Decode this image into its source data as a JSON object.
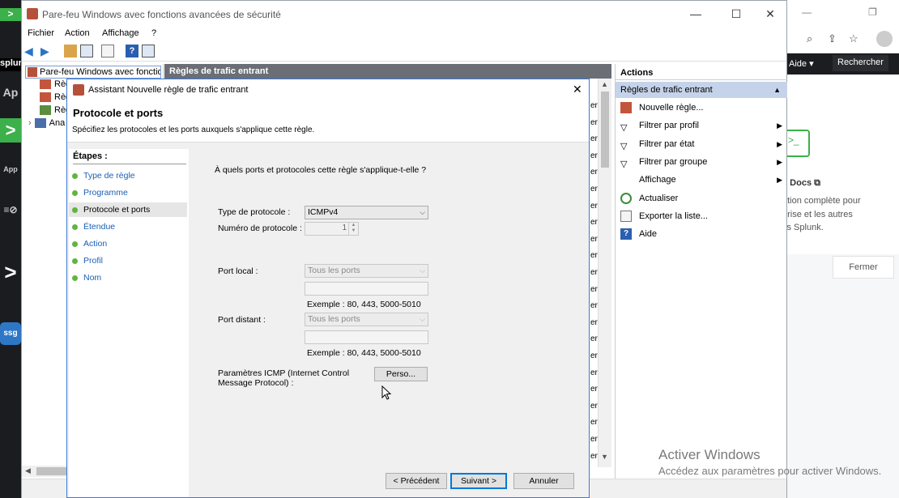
{
  "background": {
    "right_top_labels": [
      "Aide ▾",
      "Rechercher"
    ],
    "card_title": "k Docs",
    "card_lines": [
      "ation complète pour",
      "prise et les autres",
      "its Splunk."
    ],
    "close_button": "Fermer",
    "left_tiles": [
      ">",
      "Ap",
      ">",
      "App",
      "≡⊘",
      ">",
      "ssg"
    ],
    "brand": "splun"
  },
  "mmc": {
    "title": "Pare-feu Windows avec fonctions avancées de sécurité",
    "menu": [
      "Fichier",
      "Action",
      "Affichage",
      "?"
    ],
    "tree": {
      "root": "Pare-feu Windows avec fonctio",
      "nodes": [
        "Règ",
        "Règ",
        "Règ",
        "Ana"
      ]
    },
    "center_header": "Règles de trafic entrant",
    "list_marker": "er",
    "actions": {
      "header": "Actions",
      "section": "Règles de trafic entrant",
      "items": [
        {
          "label": "Nouvelle règle...",
          "icon": "new-rule-icon",
          "submenu": false
        },
        {
          "label": "Filtrer par profil",
          "icon": "filter-icon",
          "submenu": true
        },
        {
          "label": "Filtrer par état",
          "icon": "filter-icon",
          "submenu": true
        },
        {
          "label": "Filtrer par groupe",
          "icon": "filter-icon",
          "submenu": true
        },
        {
          "label": "Affichage",
          "icon": "none",
          "submenu": true
        },
        {
          "label": "Actualiser",
          "icon": "refresh-icon",
          "submenu": false
        },
        {
          "label": "Exporter la liste...",
          "icon": "export-icon",
          "submenu": false
        },
        {
          "label": "Aide",
          "icon": "help-icon",
          "submenu": false
        }
      ]
    }
  },
  "wizard": {
    "title": "Assistant Nouvelle règle de trafic entrant",
    "heading": "Protocole et ports",
    "description": "Spécifiez les protocoles et les ports auxquels s'applique cette règle.",
    "steps_title": "Étapes :",
    "steps": [
      "Type de règle",
      "Programme",
      "Protocole et ports",
      "Étendue",
      "Action",
      "Profil",
      "Nom"
    ],
    "current_step": "Protocole et ports",
    "question": "À quels ports et protocoles cette règle s'applique-t-elle ?",
    "protocol_type_label": "Type de protocole :",
    "protocol_type_value": "ICMPv4",
    "protocol_number_label": "Numéro de protocole :",
    "protocol_number_value": "1",
    "local_port_label": "Port local :",
    "local_port_value": "Tous les ports",
    "remote_port_label": "Port distant :",
    "remote_port_value": "Tous les ports",
    "example": "Exemple : 80, 443, 5000-5010",
    "icmp_label_1": "Paramètres ICMP (Internet Control",
    "icmp_label_2": "Message Protocol) :",
    "custom_button": "Perso...",
    "prev_button": "< Précédent",
    "next_button": "Suivant >",
    "cancel_button": "Annuler"
  },
  "watermark": {
    "line1": "Activer Windows",
    "line2": "Accédez aux paramètres pour activer Windows."
  }
}
